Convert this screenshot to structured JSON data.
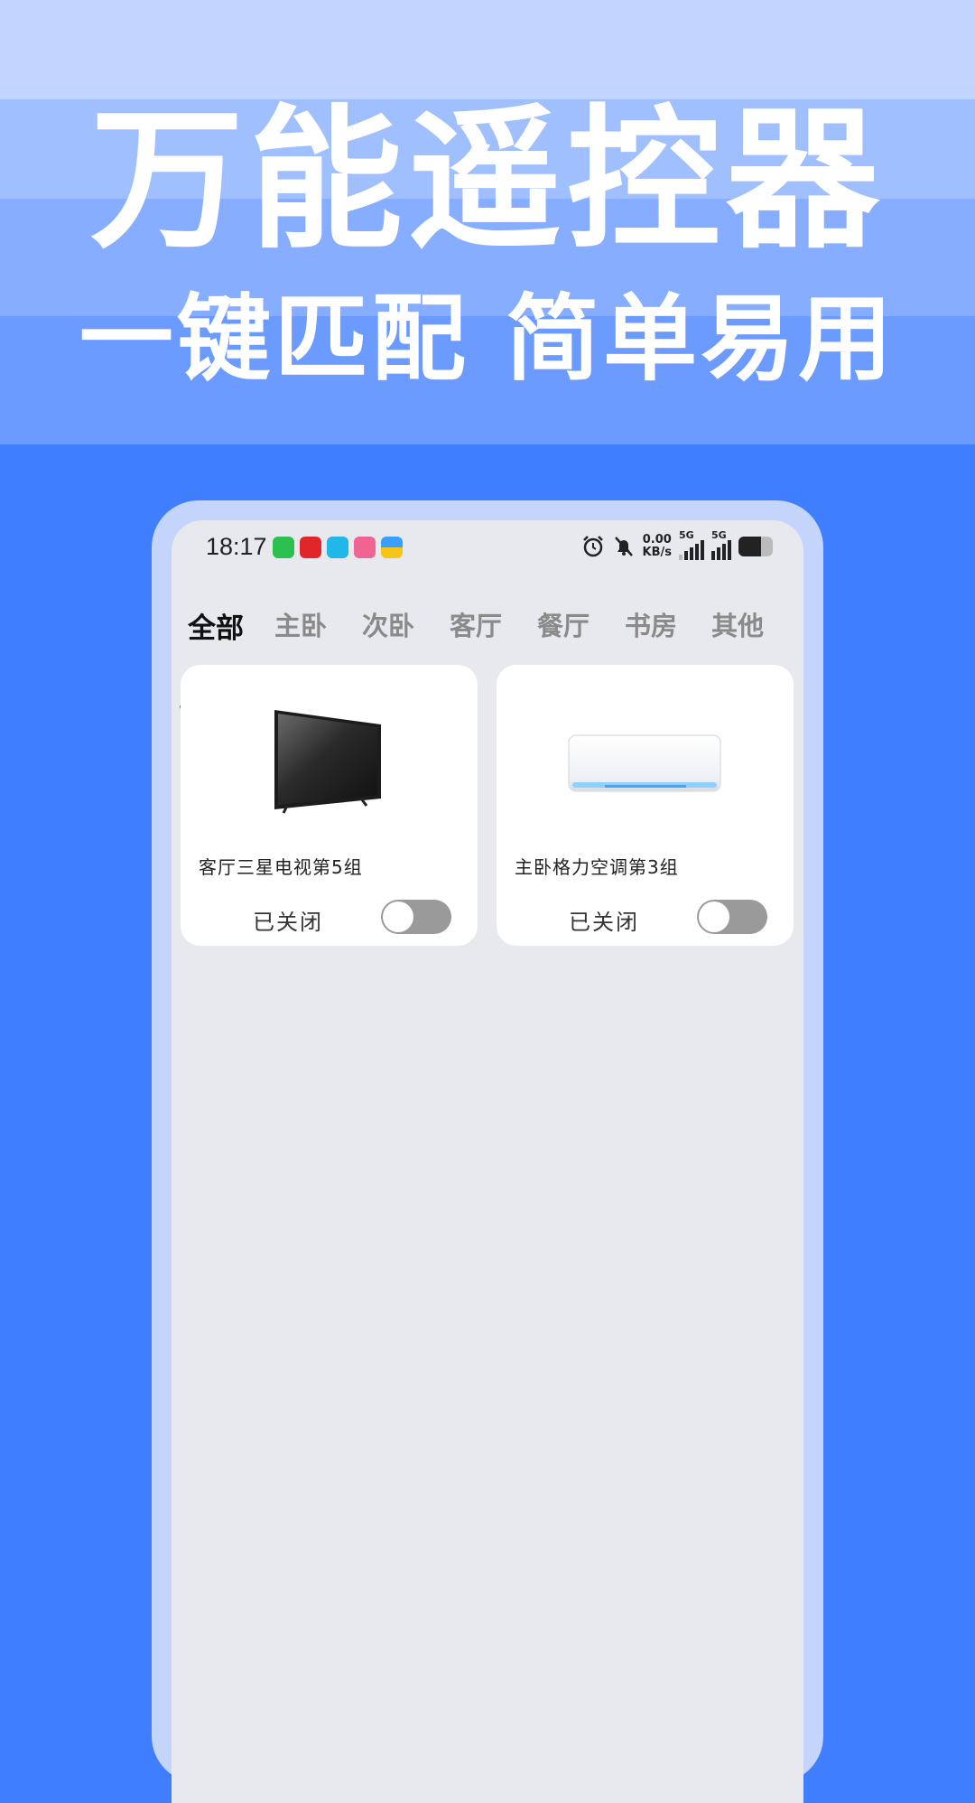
{
  "hero": {
    "title": "万能遥控器",
    "subtitle": "一键匹配 简单易用"
  },
  "status_bar": {
    "time": "18:17",
    "net_speed_value": "0.00",
    "net_speed_unit": "KB/s",
    "signal1_label": "5G",
    "signal2_label": "5G",
    "battery_level": 0.65
  },
  "tabs": [
    {
      "label": "全部",
      "active": true
    },
    {
      "label": "主卧",
      "active": false
    },
    {
      "label": "次卧",
      "active": false
    },
    {
      "label": "客厅",
      "active": false
    },
    {
      "label": "餐厅",
      "active": false
    },
    {
      "label": "书房",
      "active": false
    },
    {
      "label": "其他",
      "active": false
    }
  ],
  "devices": [
    {
      "name": "客厅三星电视第5组",
      "status": "已关闭",
      "icon": "tv-icon",
      "on": false
    },
    {
      "name": "主卧格力空调第3组",
      "status": "已关闭",
      "icon": "air-conditioner-icon",
      "on": false
    }
  ],
  "colors": {
    "background": "#3f7fff",
    "tab_active_underline": "#2f6fe6",
    "toggle_off": "#9a9a9a"
  }
}
